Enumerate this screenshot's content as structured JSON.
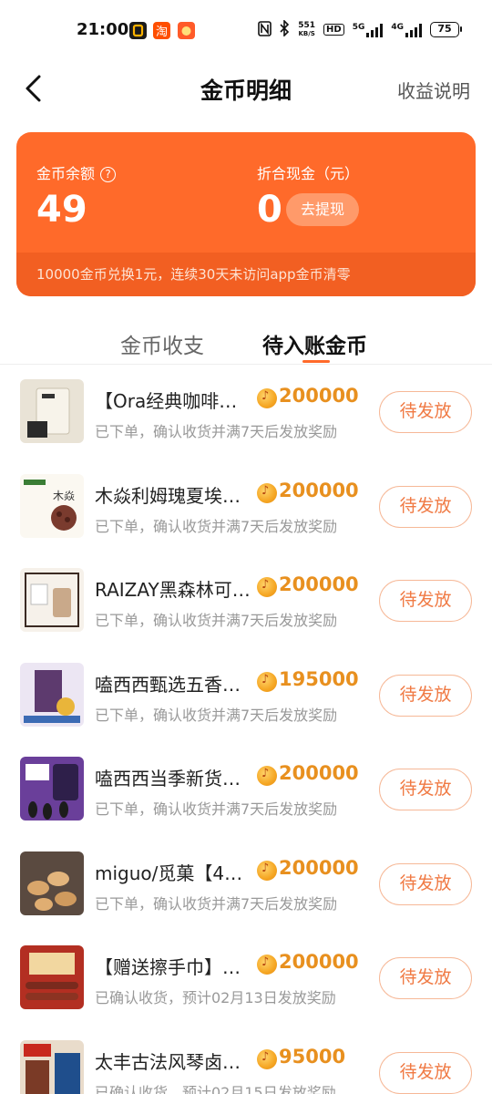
{
  "status_bar": {
    "time": "21:00",
    "net_speed": "551",
    "net_unit": "KB/S",
    "hd": "HD",
    "sig1": "5G",
    "sig2": "4G",
    "battery": "75",
    "colors": {
      "app1": "#1b1b1b",
      "app2": "#ff4f00",
      "app3": "#ff5b29"
    }
  },
  "header": {
    "title": "金币明细",
    "right_link": "收益说明"
  },
  "balance_card": {
    "coin_label": "金币余额",
    "coin_value": "49",
    "cash_label": "折合现金（元）",
    "cash_value": "0",
    "withdraw_label": "去提现",
    "note": "10000金币兑换1元，连续30天未访问app金币清零",
    "color": "#ff6a2a"
  },
  "tabs": [
    {
      "label": "金币收支",
      "active": false
    },
    {
      "label": "待入账金币",
      "active": true
    }
  ],
  "items": [
    {
      "name": "【Ora经典咖啡…",
      "amount": "200000",
      "status": "已下单，确认收货并满7天后发放奖励",
      "button": "待发放",
      "thumb": "coffee-bag"
    },
    {
      "name": "木焱利姆瑰夏埃…",
      "amount": "200000",
      "status": "已下单，确认收货并满7天后发放奖励",
      "button": "待发放",
      "thumb": "coffee-beans"
    },
    {
      "name": "RAIZAY黑森林可…",
      "amount": "200000",
      "status": "已下单，确认收货并满7天后发放奖励",
      "button": "待发放",
      "thumb": "cocoa-pack"
    },
    {
      "name": "嗑西西甄选五香…",
      "amount": "195000",
      "status": "已下单，确认收货并满7天后发放奖励",
      "button": "待发放",
      "thumb": "seeds-bag"
    },
    {
      "name": "嗑西西当季新货…",
      "amount": "200000",
      "status": "已下单，确认收货并满7天后发放奖励",
      "button": "待发放",
      "thumb": "seeds-purple"
    },
    {
      "name": "miguo/觅菓【4…",
      "amount": "200000",
      "status": "已下单，确认收货并满7天后发放奖励",
      "button": "待发放",
      "thumb": "cashews"
    },
    {
      "name": "【赠送擦手巾】…",
      "amount": "200000",
      "status": "已确认收货，预计02月13日发放奖励",
      "button": "待发放",
      "thumb": "sausage"
    },
    {
      "name": "太丰古法风琴卤…",
      "amount": "95000",
      "status": "已确认收货，预计02月15日发放奖励",
      "button": "待发放",
      "thumb": "braised-meat"
    }
  ],
  "colors": {
    "accent": "#ff6a2a",
    "amount": "#e8901f",
    "button_text": "#f07a44"
  }
}
